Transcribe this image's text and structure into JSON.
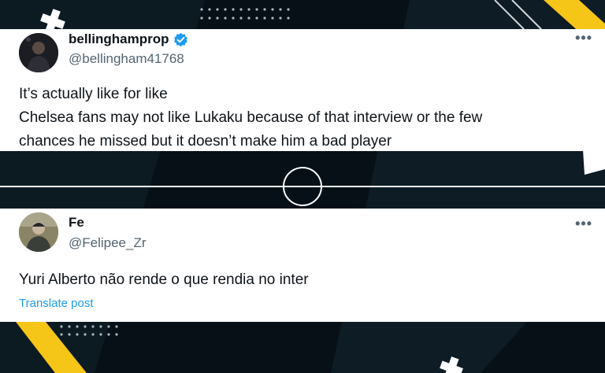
{
  "colors": {
    "background": "#071016",
    "accent_yellow": "#f5c518",
    "verified_blue": "#1d9bf0",
    "link_blue": "#1d9bf0",
    "text": "#0f1419",
    "secondary_text": "#536471"
  },
  "tweets": [
    {
      "display_name": "bellinghamprop",
      "verified": true,
      "handle": "@bellingham41768",
      "more_label": "•••",
      "avatar_icon": "avatar-photo",
      "lines": [
        "It’s actually like for like",
        "Chelsea fans may not like Lukaku because of that interview or the few",
        "chances he missed but it doesn’t make him a bad player"
      ]
    },
    {
      "display_name": "Fe",
      "verified": false,
      "handle": "@Felipee_Zr",
      "more_label": "•••",
      "avatar_icon": "avatar-photo",
      "lines": [
        "Yuri Alberto não rende o que rendia no inter"
      ],
      "translate_label": "Translate post"
    }
  ]
}
